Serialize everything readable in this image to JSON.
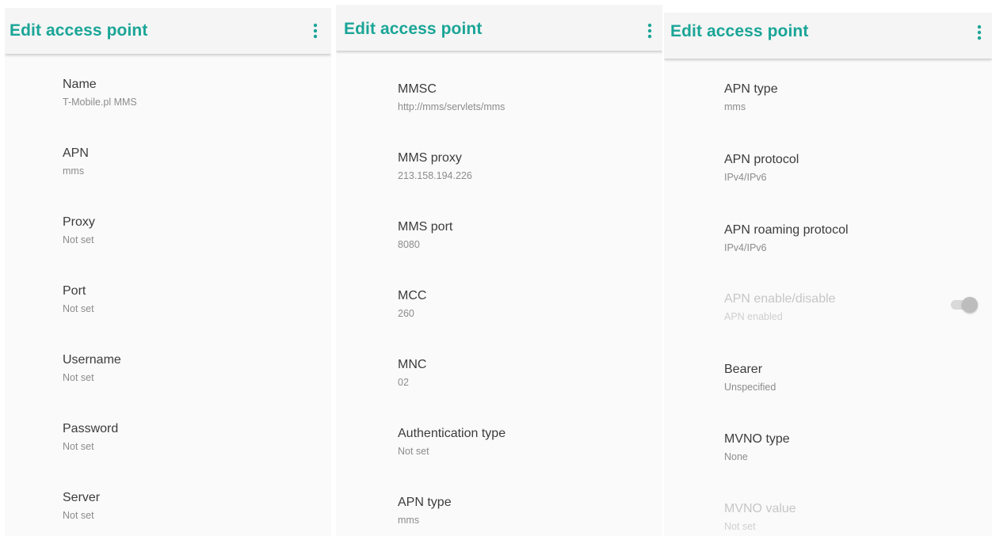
{
  "panels": [
    {
      "title": "Edit access point",
      "menu_icon": "more-vert-icon",
      "items": [
        {
          "title": "Name",
          "summary": "T-Mobile.pl MMS"
        },
        {
          "title": "APN",
          "summary": "mms"
        },
        {
          "title": "Proxy",
          "summary": "Not set"
        },
        {
          "title": "Port",
          "summary": "Not set"
        },
        {
          "title": "Username",
          "summary": "Not set"
        },
        {
          "title": "Password",
          "summary": "Not set"
        },
        {
          "title": "Server",
          "summary": "Not set"
        }
      ]
    },
    {
      "title": "Edit access point",
      "menu_icon": "more-vert-icon",
      "items": [
        {
          "title": "MMSC",
          "summary": "http://mms/servlets/mms"
        },
        {
          "title": "MMS proxy",
          "summary": "213.158.194.226"
        },
        {
          "title": "MMS port",
          "summary": "8080"
        },
        {
          "title": "MCC",
          "summary": "260"
        },
        {
          "title": "MNC",
          "summary": "02"
        },
        {
          "title": "Authentication type",
          "summary": "Not set"
        },
        {
          "title": "APN type",
          "summary": "mms"
        }
      ]
    },
    {
      "title": "Edit access point",
      "menu_icon": "more-vert-icon",
      "items": [
        {
          "title": "APN type",
          "summary": "mms"
        },
        {
          "title": "APN protocol",
          "summary": "IPv4/IPv6"
        },
        {
          "title": "APN roaming protocol",
          "summary": "IPv4/IPv6"
        },
        {
          "title": "APN enable/disable",
          "summary": "APN enabled",
          "disabled": true,
          "toggle_on": true
        },
        {
          "title": "Bearer",
          "summary": "Unspecified"
        },
        {
          "title": "MVNO type",
          "summary": "None"
        },
        {
          "title": "MVNO value",
          "summary": "Not set",
          "disabled": true
        }
      ]
    }
  ],
  "colors": {
    "accent": "#1aa597",
    "title_text": "#3c3c3c",
    "summary_text": "#8c8c8c",
    "disabled_text": "#c6c6c6",
    "appbar_bg": "#f5f5f5",
    "content_bg": "#fafafa"
  }
}
